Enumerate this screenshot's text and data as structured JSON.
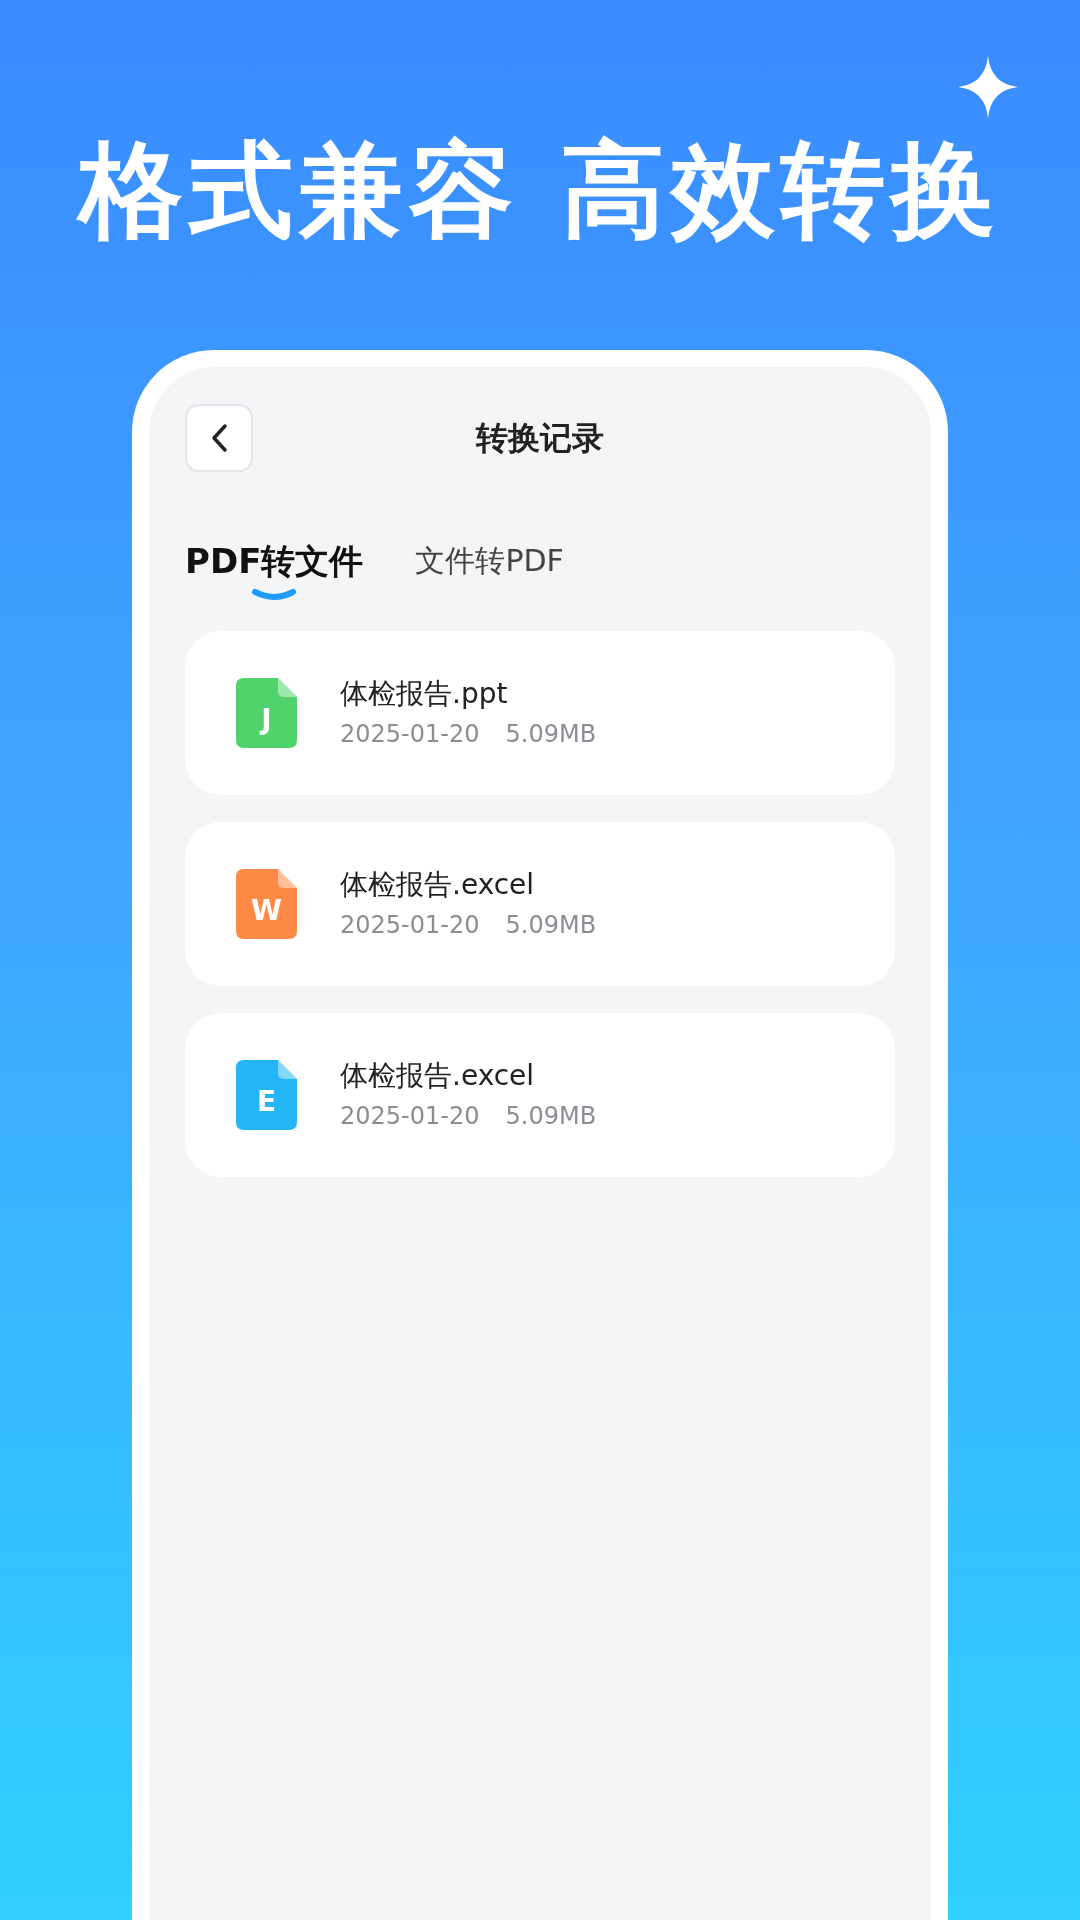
{
  "headline": "格式兼容 高效转换",
  "screen": {
    "title": "转换记录",
    "tabs": [
      {
        "label": "PDF转文件",
        "selected": true
      },
      {
        "label": "文件转PDF",
        "selected": false
      }
    ],
    "files": [
      {
        "letter": "J",
        "color": "#4fd46b",
        "name": "体检报告.ppt",
        "date": "2025-01-20",
        "size": "5.09MB"
      },
      {
        "letter": "W",
        "color": "#ff8a45",
        "name": "体检报告.excel",
        "date": "2025-01-20",
        "size": "5.09MB"
      },
      {
        "letter": "E",
        "color": "#23b5f5",
        "name": "体检报告.excel",
        "date": "2025-01-20",
        "size": "5.09MB"
      }
    ]
  }
}
